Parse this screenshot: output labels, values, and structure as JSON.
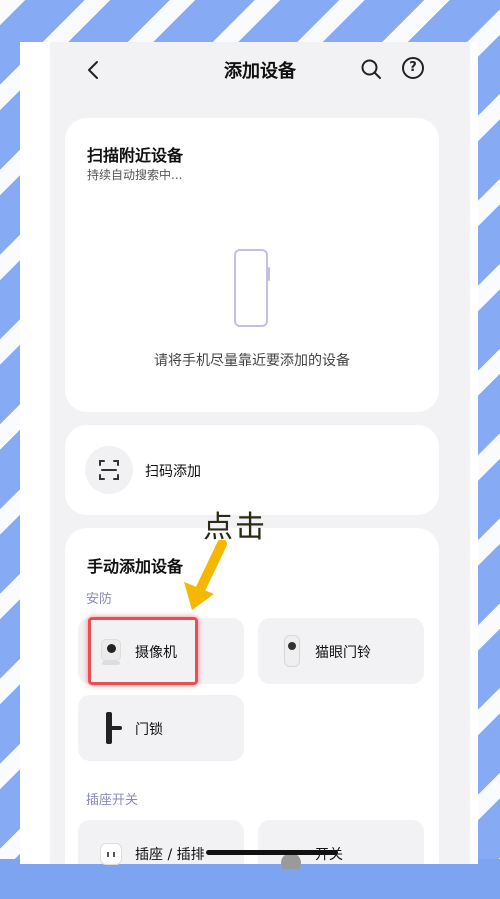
{
  "header": {
    "title": "添加设备",
    "back_icon": "chevron-left-icon",
    "search_icon": "search-icon",
    "help_icon": "help-circle-icon",
    "help_glyph": "?"
  },
  "scan": {
    "title": "扫描附近设备",
    "subtitle": "持续自动搜索中...",
    "hint": "请将手机尽量靠近要添加的设备",
    "illustration": "phone-outline-icon"
  },
  "qr": {
    "label": "扫码添加",
    "icon": "scan-qr-icon"
  },
  "manual": {
    "title": "手动添加设备",
    "sections": [
      {
        "name": "安防",
        "items": [
          {
            "label": "摄像机",
            "icon": "camera-icon"
          },
          {
            "label": "猫眼门铃",
            "icon": "peephole-doorbell-icon"
          },
          {
            "label": "门锁",
            "icon": "door-lock-icon"
          }
        ]
      },
      {
        "name": "插座开关",
        "items": [
          {
            "label": "插座 / 插排",
            "icon": "socket-icon"
          },
          {
            "label": "开关",
            "icon": "switch-icon"
          }
        ]
      }
    ]
  },
  "annotation": {
    "text": "点击",
    "arrow_color": "#f5b700",
    "highlight_color": "#e84f55"
  },
  "colors": {
    "background_blue": "#86aaf3",
    "section_label": "#8a8ab8",
    "tile_bg": "#f2f2f4"
  }
}
